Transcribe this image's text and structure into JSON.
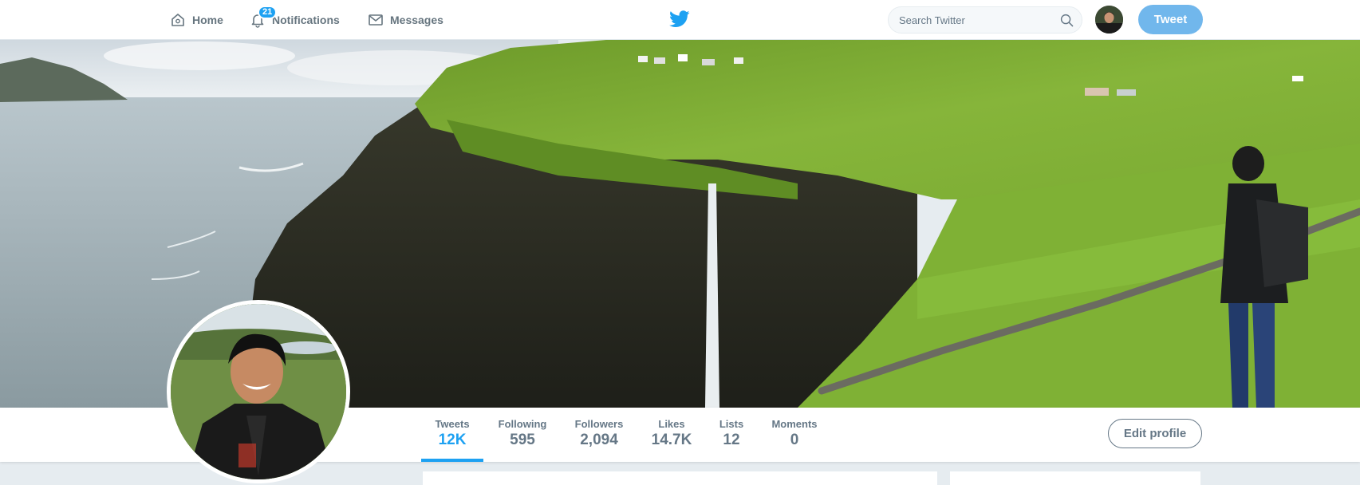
{
  "nav": {
    "home_label": "Home",
    "notifications_label": "Notifications",
    "notifications_count": "21",
    "messages_label": "Messages",
    "brand_icon": "twitter-bird-icon",
    "search_placeholder": "Search Twitter",
    "tweet_button_label": "Tweet"
  },
  "profile_nav": {
    "stats": [
      {
        "label": "Tweets",
        "value": "12K",
        "active": true
      },
      {
        "label": "Following",
        "value": "595",
        "active": false
      },
      {
        "label": "Followers",
        "value": "2,094",
        "active": false
      },
      {
        "label": "Likes",
        "value": "14.7K",
        "active": false
      },
      {
        "label": "Lists",
        "value": "12",
        "active": false
      },
      {
        "label": "Moments",
        "value": "0",
        "active": false
      }
    ],
    "edit_profile_label": "Edit profile"
  },
  "colors": {
    "accent": "#1da1f2",
    "tweet_button": "#71b7ec",
    "muted_text": "#657786",
    "page_background": "#e6ecf0"
  }
}
